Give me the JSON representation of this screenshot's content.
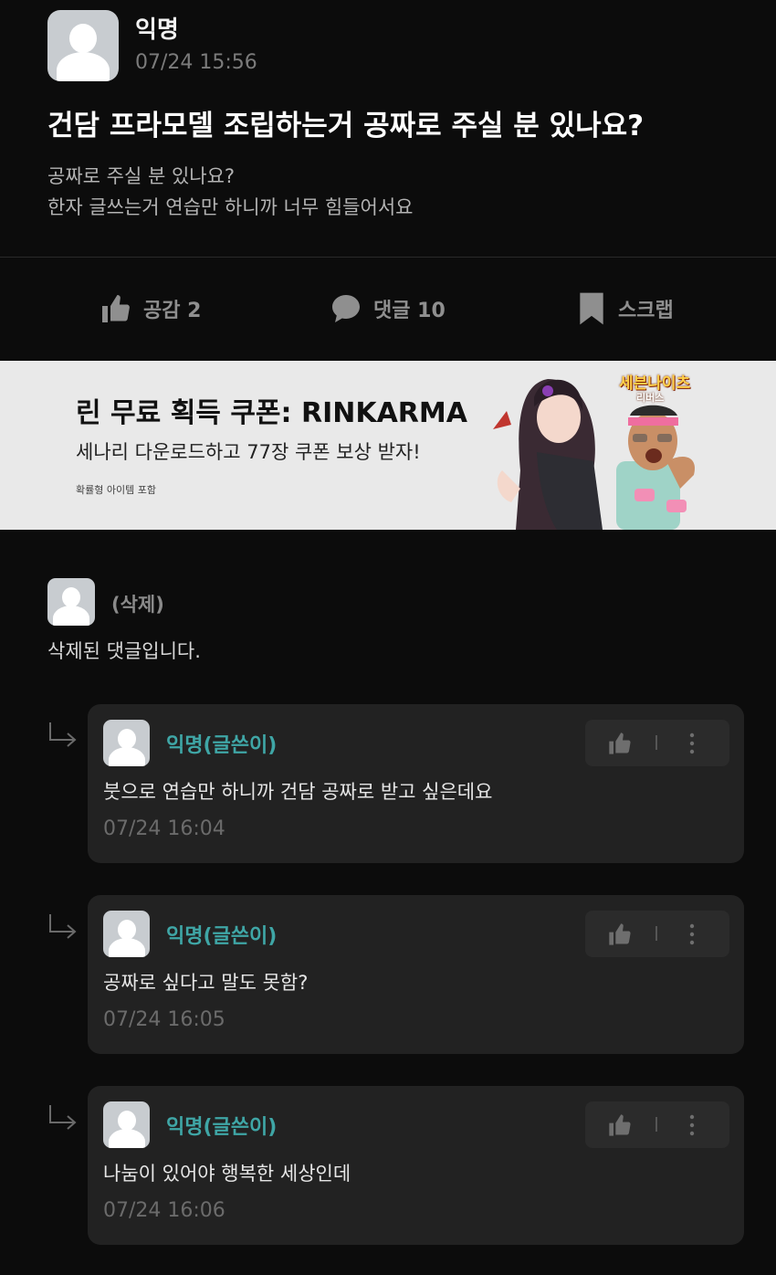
{
  "post": {
    "author": "익명",
    "date": "07/24 15:56",
    "title": "건담 프라모델 조립하는거 공짜로 주실 분 있나요?",
    "body_line1": "공짜로 주실 분 있나요?",
    "body_line2": "한자 글쓰는거 연습만 하니까 너무 힘들어서요"
  },
  "actions": {
    "like_label": "공감 2",
    "comment_label": "댓글 10",
    "scrap_label": "스크랩"
  },
  "ad": {
    "title": "린 무료 획득 쿠폰: RINKARMA",
    "subtitle": "세나리 다운로드하고 77장 쿠폰 보상 받자!",
    "note": "확률형 아이템 포함",
    "logo": "세븐나이츠",
    "logo_sub": "리버스"
  },
  "deleted_comment": {
    "name": "(삭제)",
    "text": "삭제된 댓글입니다."
  },
  "replies": [
    {
      "name": "익명(글쓴이)",
      "text": "붓으로 연습만 하니까 건담 공짜로 받고 싶은데요",
      "date": "07/24 16:04"
    },
    {
      "name": "익명(글쓴이)",
      "text": "공짜로 싶다고 말도 못함?",
      "date": "07/24 16:05"
    },
    {
      "name": "익명(글쓴이)",
      "text": "나눔이 있어야 행복한 세상인데",
      "date": "07/24 16:06"
    }
  ],
  "colors": {
    "background": "#0c0c0c",
    "reply_card": "#222222",
    "author_accent": "#3fa6a6",
    "muted": "#7b7b7b"
  },
  "icons": [
    "thumbs-up-icon",
    "speech-bubble-icon",
    "bookmark-icon",
    "reply-arrow-icon",
    "more-vertical-icon",
    "avatar-icon"
  ]
}
